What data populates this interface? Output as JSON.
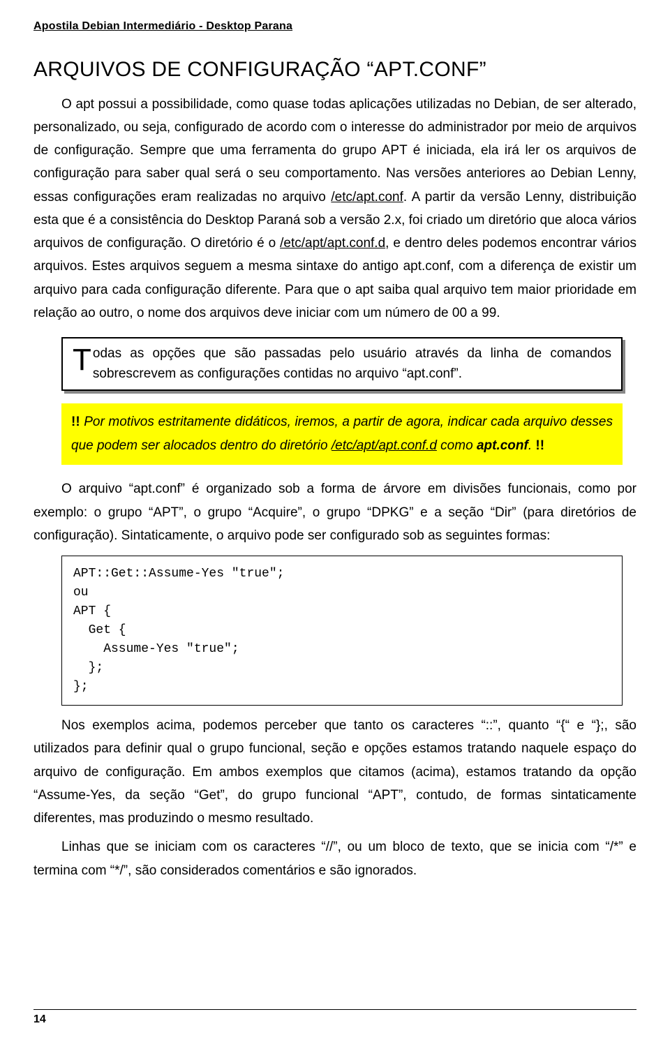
{
  "header": "Apostila Debian  Intermediário - Desktop Parana",
  "title": "ARQUIVOS DE CONFIGURAÇÃO “APT.CONF”",
  "para1_a": "O apt possui a possibilidade, como quase todas aplicações utilizadas no Debian, de ser alterado, personalizado, ou seja, configurado de acordo com o interesse do administrador por meio de arquivos de configuração. Sempre que uma ferramenta do grupo APT é iniciada, ela irá ler os arquivos de configuração para saber qual será o seu comportamento. Nas versões anteriores ao Debian Lenny, essas configurações eram realizadas no arquivo ",
  "path1": "/etc/apt.conf",
  "para1_b": ". A partir da versão Lenny, distribuição esta que é a consistência do Desktop Paraná sob a versão 2.x, foi criado um diretório que aloca vários arquivos de configuração. O diretório é o ",
  "path2": "/etc/apt/apt.conf.d",
  "para1_c": ", e dentro deles podemos encontrar vários arquivos. Estes arquivos seguem a mesma sintaxe do antigo apt.conf, com a diferença de existir um arquivo para cada configuração diferente. Para que o apt saiba qual arquivo tem maior prioridade em relação ao outro, o nome dos arquivos deve iniciar com um número de 00 a 99.",
  "callout_dropcap": "T",
  "callout_rest": "odas as opções que são passadas pelo usuário através da linha de comandos sobrescrevem as configurações contidas no arquivo “apt.conf”.",
  "hl_bang": "!!",
  "hl_a": " Por motivos estritamente didáticos, iremos, a partir de agora, indicar cada arquivo desses que podem ser alocados dentro do diretório ",
  "hl_path": "/etc/apt/apt.conf.d",
  "hl_b": " como ",
  "hl_bold": "apt.conf",
  "hl_c": ". ",
  "para2_a": "O arquivo “apt.conf” é organizado sob a forma de árvore em divisões funcionais, como por exemplo: o grupo “APT”, o grupo “Acquire”, o grupo “DPKG” e a seção “Dir” (para diretórios de configuração). Sintaticamente, o arquivo pode ser configurado sob as seguintes formas:",
  "code": "APT::Get::Assume-Yes \"true\";\nou\nAPT {\n  Get {\n    Assume-Yes \"true\";\n  };\n};",
  "para3": "Nos exemplos acima, podemos perceber que tanto os caracteres “::”, quanto “{“ e “};, são utilizados para definir qual o grupo funcional, seção e opções estamos tratando naquele espaço do arquivo de configuração. Em ambos exemplos que citamos (acima), estamos tratando da opção “Assume-Yes, da seção “Get”, do grupo funcional “APT”, contudo, de formas sintaticamente diferentes, mas produzindo o mesmo resultado.",
  "para4": "Linhas que se iniciam com os caracteres “//”, ou um bloco de texto, que se inicia com “/*” e termina com “*/”, são considerados comentários e são ignorados.",
  "page_number": "14"
}
